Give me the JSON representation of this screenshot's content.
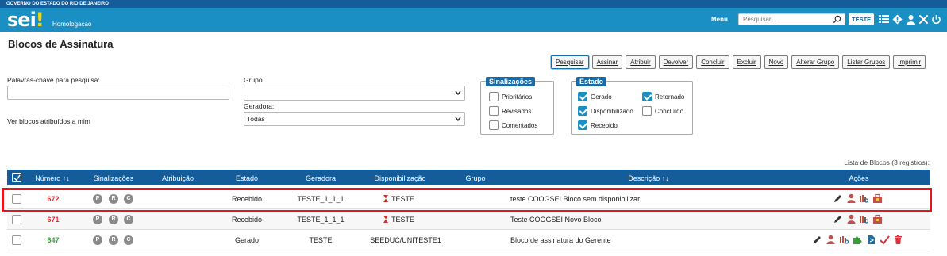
{
  "gov_bar": "GOVERNO DO ESTADO DO RIO DE JANEIRO",
  "header": {
    "logo": "sei",
    "environment": "Homologacao",
    "menu": "Menu",
    "search_placeholder": "Pesquisar...",
    "user": "TESTE",
    "icons": [
      "search-icon",
      "grid-icon",
      "info-icon",
      "user-icon",
      "tools-icon",
      "power-icon"
    ]
  },
  "page_title": "Blocos de Assinatura",
  "toolbar": [
    "Pesquisar",
    "Assinar",
    "Atribuir",
    "Devolver",
    "Concluir",
    "Excluir",
    "Novo",
    "Alterar Grupo",
    "Listar Grupos",
    "Imprimir"
  ],
  "form": {
    "keywords_label": "Palavras-chave para pesquisa:",
    "keywords_value": "",
    "group_label": "Grupo",
    "group_value": "",
    "generator_label": "Geradora:",
    "generator_value": "Todas",
    "assigned_label": "Ver blocos atribuídos a mim"
  },
  "signals": {
    "legend": "Sinalizações",
    "items": [
      {
        "label": "Prioritários",
        "checked": false
      },
      {
        "label": "Revisados",
        "checked": false
      },
      {
        "label": "Comentados",
        "checked": false
      }
    ]
  },
  "state": {
    "legend": "Estado",
    "items": [
      {
        "label": "Gerado",
        "checked": true
      },
      {
        "label": "Retornado",
        "checked": true
      },
      {
        "label": "Disponibilizado",
        "checked": true
      },
      {
        "label": "Concluído",
        "checked": false
      },
      {
        "label": "Recebido",
        "checked": true
      }
    ]
  },
  "list_caption": "Lista de Blocos (3 registros):",
  "table": {
    "headers": {
      "numero": "Número",
      "sinalizacoes": "Sinalizações",
      "atribuicao": "Atribuição",
      "estado": "Estado",
      "geradora": "Geradora",
      "disponibilizacao": "Disponibilização",
      "grupo": "Grupo",
      "descricao": "Descrição",
      "acoes": "Ações"
    },
    "rows": [
      {
        "numero": "672",
        "numero_color": "#d8323c",
        "badges": [
          "P",
          "R",
          "C"
        ],
        "atribuicao": "",
        "estado": "Recebido",
        "geradora": "TESTE_1_1_1",
        "disponibilizacao": "TESTE",
        "grupo": "",
        "descricao": "teste COOGSEI Bloco sem disponibilizar",
        "acoes": [
          "pen-icon",
          "user-icon",
          "bookcase-search-icon",
          "briefcase-icon"
        ]
      },
      {
        "numero": "671",
        "numero_color": "#d8323c",
        "badges": [
          "P",
          "R",
          "C"
        ],
        "atribuicao": "",
        "estado": "Recebido",
        "geradora": "TESTE_1_1_1",
        "disponibilizacao": "TESTE",
        "grupo": "",
        "descricao": "Teste COOGSEI Novo Bloco",
        "acoes": [
          "pen-icon",
          "user-icon",
          "bookcase-search-icon",
          "briefcase-icon"
        ]
      },
      {
        "numero": "647",
        "numero_color": "#3a9b3a",
        "badges": [
          "P",
          "R",
          "C"
        ],
        "atribuicao": "",
        "estado": "Gerado",
        "geradora": "TESTE",
        "disponibilizacao": "SEEDUC/UNITESTE1",
        "grupo": "",
        "descricao": "Bloco de assinatura do Gerente",
        "acoes": [
          "pen-icon",
          "user-icon",
          "bookcase-search-icon",
          "puzzle-icon",
          "document-send-icon",
          "checkmark-icon",
          "trash-icon"
        ]
      }
    ]
  },
  "colors": {
    "header_bg": "#1a8fc3",
    "gov_bar_bg": "#155d9a",
    "table_header_bg": "#155d9a",
    "highlight": "#e0171f",
    "number_red": "#d8323c",
    "number_green": "#3a9b3a"
  }
}
